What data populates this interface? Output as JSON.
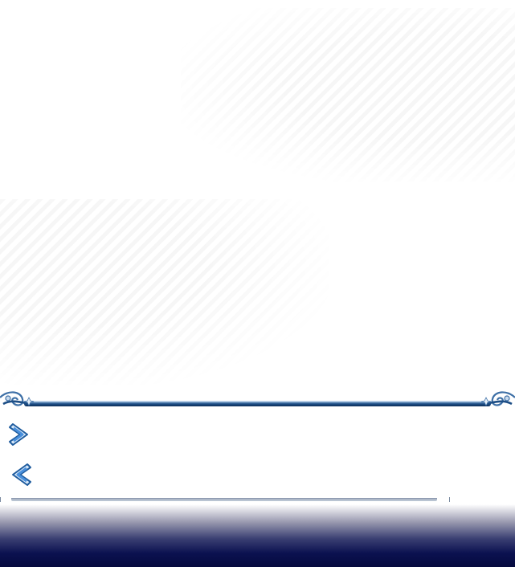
{
  "theme": {
    "divider_color": "#1d4e86",
    "arrow_color": "#2f78c8",
    "bottom_bar_color": "#050a3e"
  },
  "controls": {
    "next_icon": "chevron-right-icon",
    "prev_icon": "chevron-left-icon"
  }
}
